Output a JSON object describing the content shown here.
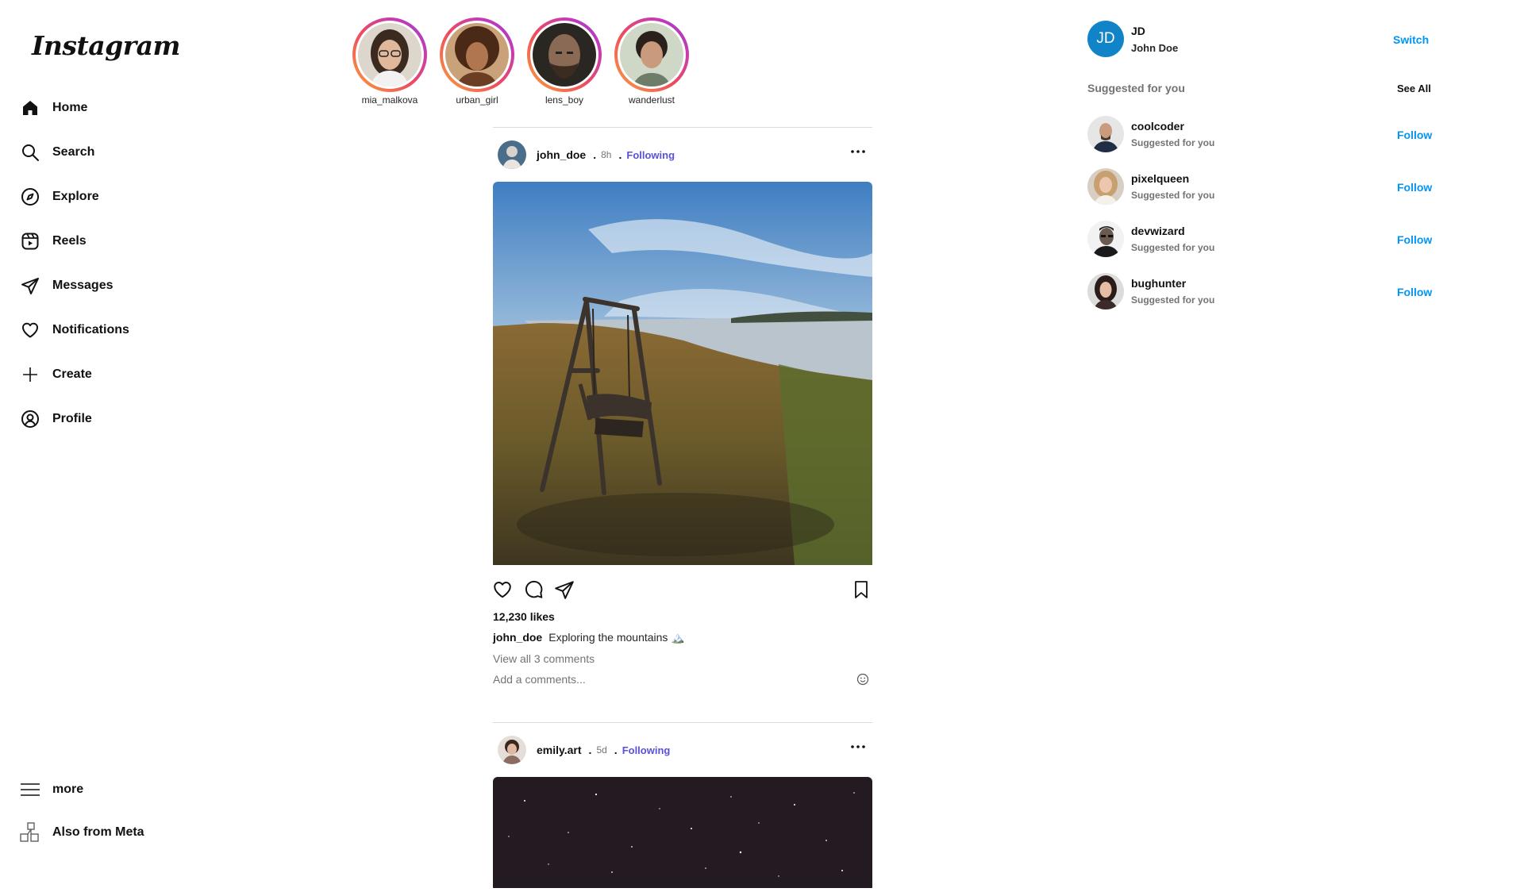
{
  "brand": {
    "logo_text": "Instagram"
  },
  "sidebar": {
    "items": [
      {
        "label": "Home",
        "icon": "home-icon"
      },
      {
        "label": "Search",
        "icon": "search-icon"
      },
      {
        "label": "Explore",
        "icon": "compass-icon"
      },
      {
        "label": "Reels",
        "icon": "reels-icon"
      },
      {
        "label": "Messages",
        "icon": "send-icon"
      },
      {
        "label": "Notifications",
        "icon": "heart-icon"
      },
      {
        "label": "Create",
        "icon": "plus-icon"
      },
      {
        "label": "Profile",
        "icon": "profile-icon"
      }
    ],
    "bottom": [
      {
        "label": "more",
        "icon": "menu-icon"
      },
      {
        "label": "Also from Meta",
        "icon": "meta-apps-icon"
      }
    ]
  },
  "stories": [
    {
      "username": "mia_malkova"
    },
    {
      "username": "urban_girl"
    },
    {
      "username": "lens_boy"
    },
    {
      "username": "wanderlust"
    }
  ],
  "posts": [
    {
      "username": "john_doe",
      "separator": ".",
      "time": "8h",
      "follow_status": "Following",
      "likes": "12,230 likes",
      "caption_user": "john_doe",
      "caption_text": "Exploring the mountains 🏔️",
      "view_comments": "View all 3 comments",
      "add_comment_placeholder": "Add a comments..."
    },
    {
      "username": "emily.art",
      "separator": ".",
      "time": "5d",
      "follow_status": "Following"
    }
  ],
  "account": {
    "initials": "JD",
    "username": "JD",
    "name": "John Doe",
    "switch_label": "Switch"
  },
  "suggestions": {
    "title": "Suggested for you",
    "see_all": "See All",
    "items": [
      {
        "username": "coolcoder",
        "subtitle": "Suggested for you",
        "action": "Follow"
      },
      {
        "username": "pixelqueen",
        "subtitle": "Suggested for you",
        "action": "Follow"
      },
      {
        "username": "devwizard",
        "subtitle": "Suggested for you",
        "action": "Follow"
      },
      {
        "username": "bughunter",
        "subtitle": "Suggested for you",
        "action": "Follow"
      }
    ]
  },
  "colors": {
    "link_blue": "#0095f6",
    "following_purple": "#5851db",
    "story_ring_start": "#f9a43c",
    "story_ring_end": "#8e3fd8",
    "account_avatar": "#1183c7"
  }
}
